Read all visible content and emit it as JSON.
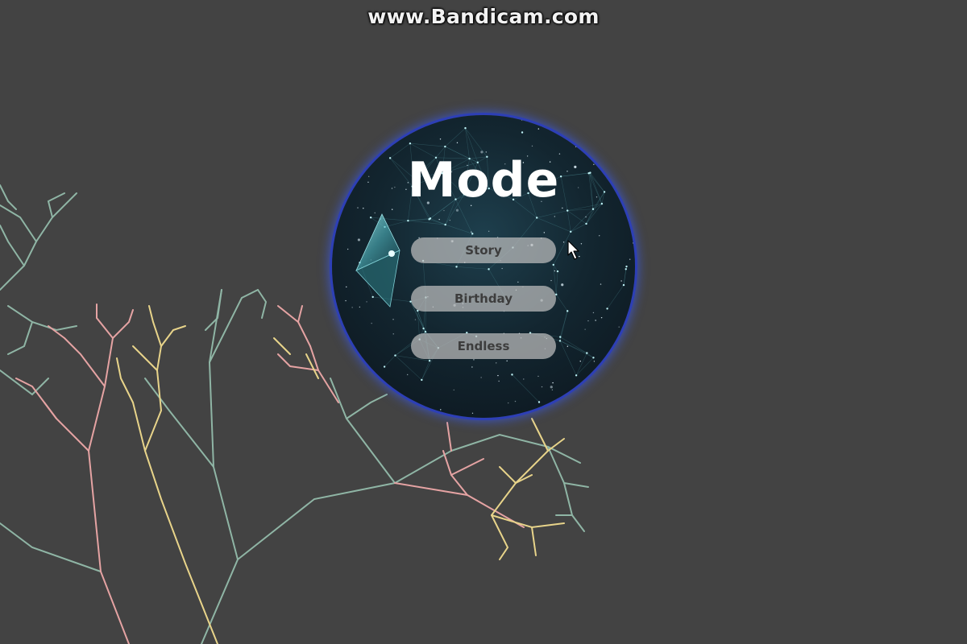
{
  "watermark": "www.Bandicam.com",
  "panel": {
    "title": "Mode",
    "buttons": [
      {
        "label": "Story"
      },
      {
        "label": "Birthday"
      },
      {
        "label": "Endless"
      }
    ],
    "back_icon": "back-arrow-icon"
  },
  "colors": {
    "background": "#434343",
    "panel_border": "#2d3fb6",
    "button_bg": "#bebebe",
    "button_text": "#3d3d3d",
    "branch_colors": [
      "#8fb5a5",
      "#e5a3a3",
      "#e8d48a"
    ]
  }
}
